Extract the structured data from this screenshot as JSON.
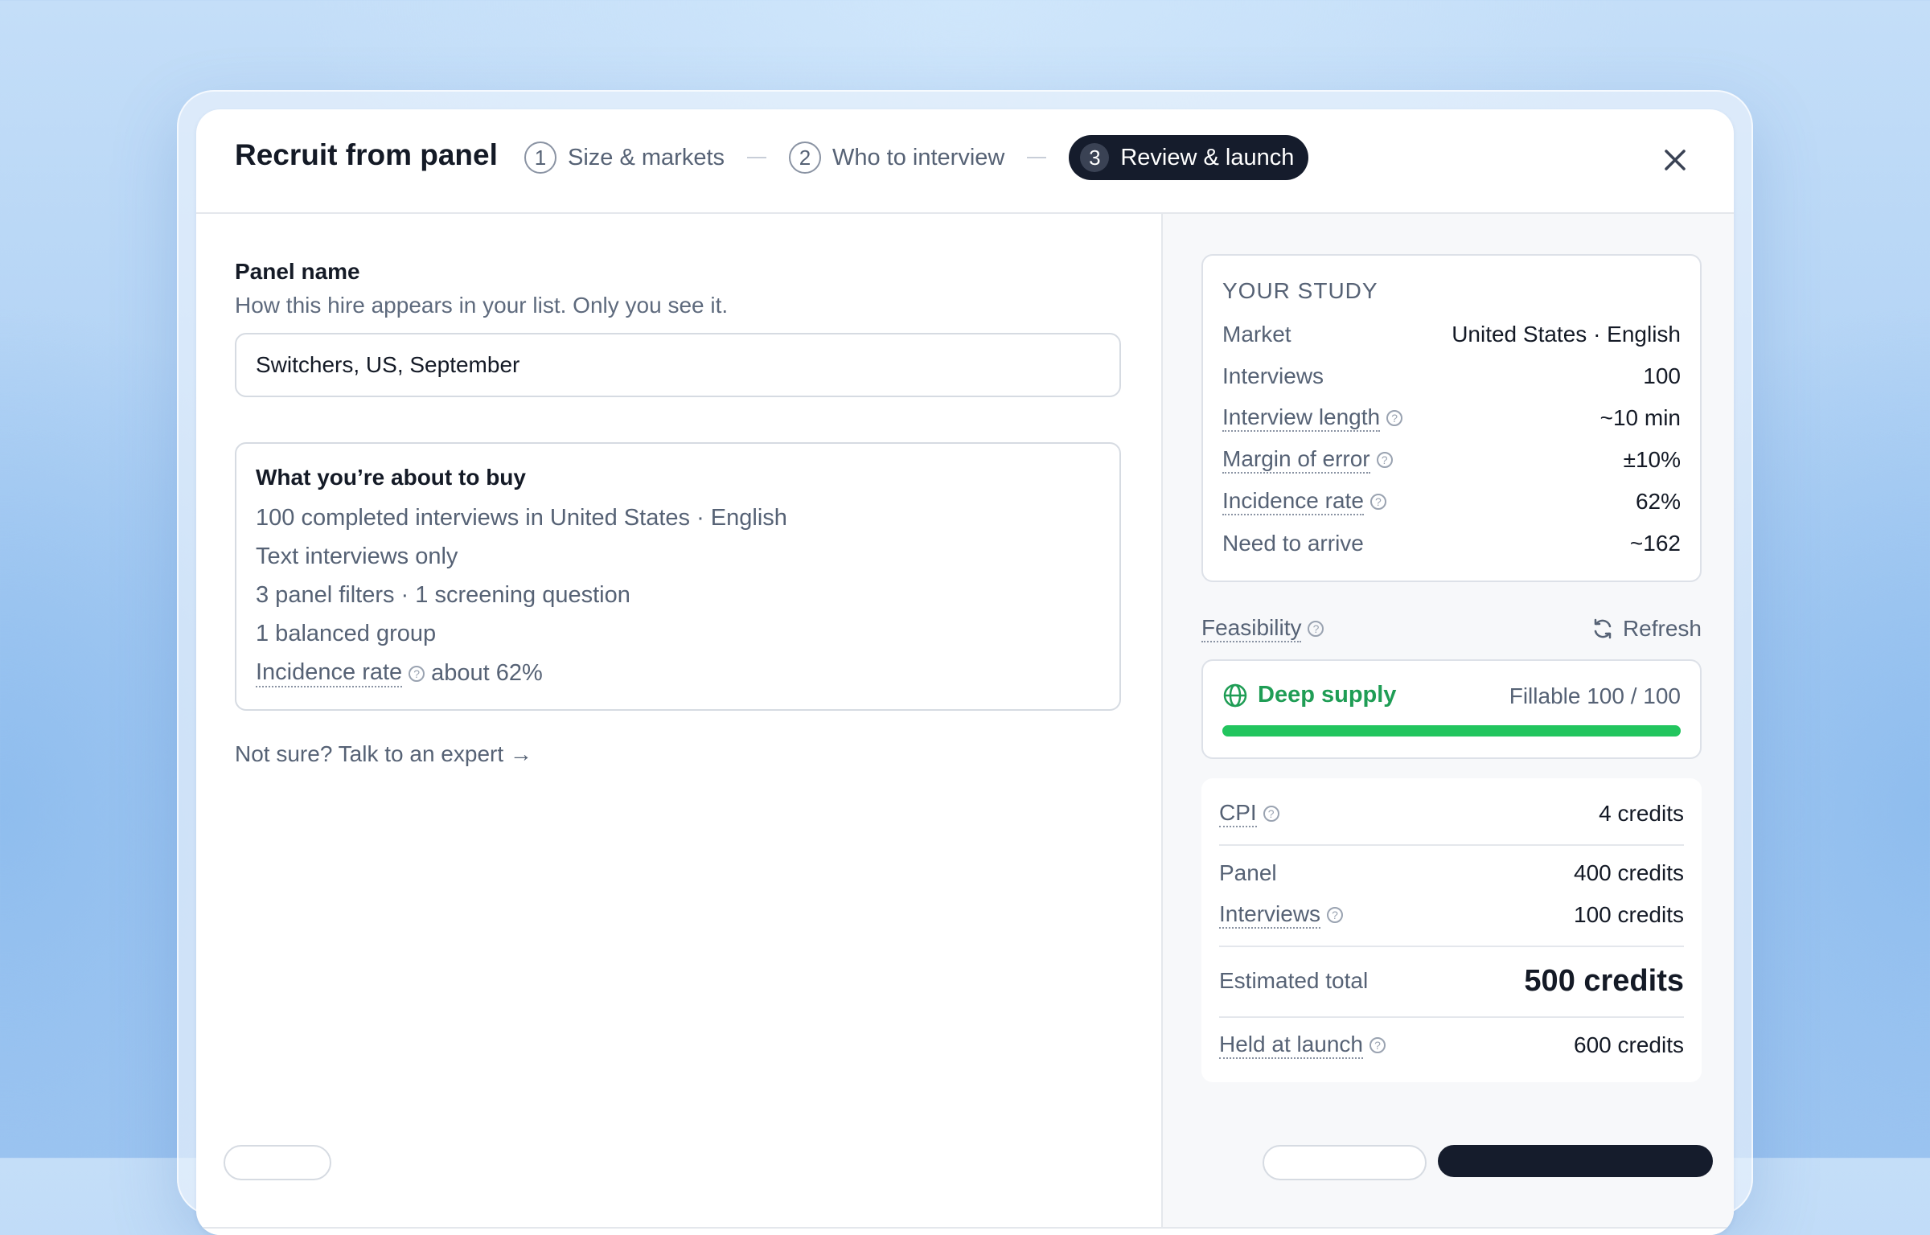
{
  "modal": {
    "title": "Recruit from panel",
    "steps": [
      {
        "num": "1",
        "label": "Size & markets",
        "active": false
      },
      {
        "num": "2",
        "label": "Who to interview",
        "active": false
      },
      {
        "num": "3",
        "label": "Review & launch",
        "active": true
      }
    ],
    "close_icon": "close-icon"
  },
  "panel_name": {
    "label": "Panel name",
    "help": "How this hire appears in your list. Only you see it.",
    "value": "Switchers, US, September"
  },
  "buy": {
    "title": "What you’re about to buy",
    "lines": [
      "100 completed interviews in United States · English",
      "Text interviews only",
      "3 panel filters · 1 screening question",
      "1 balanced group"
    ],
    "incidence_label": "Incidence rate",
    "incidence_value": "about 62%"
  },
  "expert_link": "Not sure? Talk to an expert →",
  "study": {
    "heading": "YOUR STUDY",
    "rows": [
      {
        "key": "Market",
        "value": "United States · English"
      },
      {
        "key": "Interviews",
        "value": "100"
      },
      {
        "key": "Interview length",
        "value": "~10 min"
      },
      {
        "key": "Margin of error",
        "value": "±10%"
      },
      {
        "key": "Incidence rate",
        "value": "62%"
      },
      {
        "key": "Need to arrive",
        "value": "~162"
      }
    ]
  },
  "feasibility": {
    "label": "Feasibility",
    "refresh": "Refresh",
    "supply": "Deep supply",
    "fillable": "Fillable 100 / 100",
    "fill_fraction": 1.0,
    "supply_color": "#1f9d55",
    "bar_color": "#22c55e"
  },
  "cost": {
    "cpi_label": "CPI",
    "cpi_value": "4 credits",
    "panel_label": "Panel",
    "panel_value": "400 credits",
    "interviews_label": "Interviews",
    "interviews_value": "100 credits",
    "total_label": "Estimated total",
    "total_value": "500 credits",
    "held_label": "Held at launch",
    "held_value": "600 credits"
  }
}
